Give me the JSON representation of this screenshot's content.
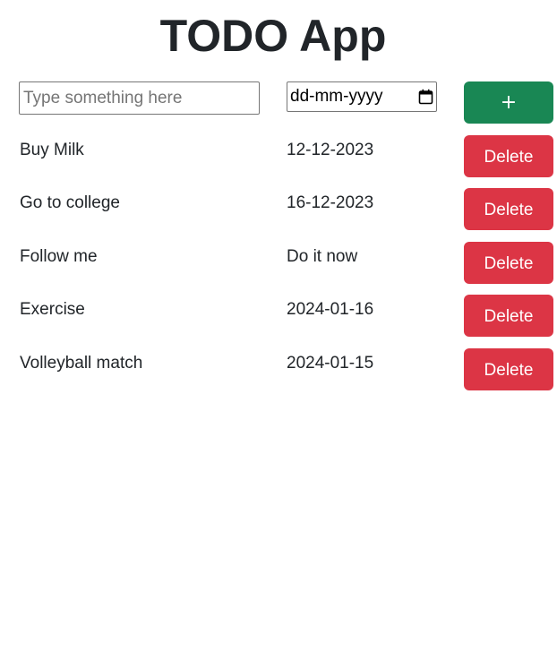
{
  "app": {
    "title": "TODO App"
  },
  "new_todo": {
    "name_placeholder": "Type something here",
    "date_placeholder": "dd-mm-yyyy",
    "add_label": "+"
  },
  "todos": [
    {
      "name": "Buy Milk",
      "date": "12-12-2023",
      "delete_label": "Delete"
    },
    {
      "name": "Go to college",
      "date": "16-12-2023",
      "delete_label": "Delete"
    },
    {
      "name": "Follow me",
      "date": "Do it now",
      "delete_label": "Delete"
    },
    {
      "name": "Exercise",
      "date": "2024-01-16",
      "delete_label": "Delete"
    },
    {
      "name": "Volleyball match",
      "date": "2024-01-15",
      "delete_label": "Delete"
    }
  ],
  "colors": {
    "add_button": "#198754",
    "delete_button": "#dc3545",
    "text": "#212529"
  },
  "icons": {
    "date_picker": "calendar-icon"
  }
}
